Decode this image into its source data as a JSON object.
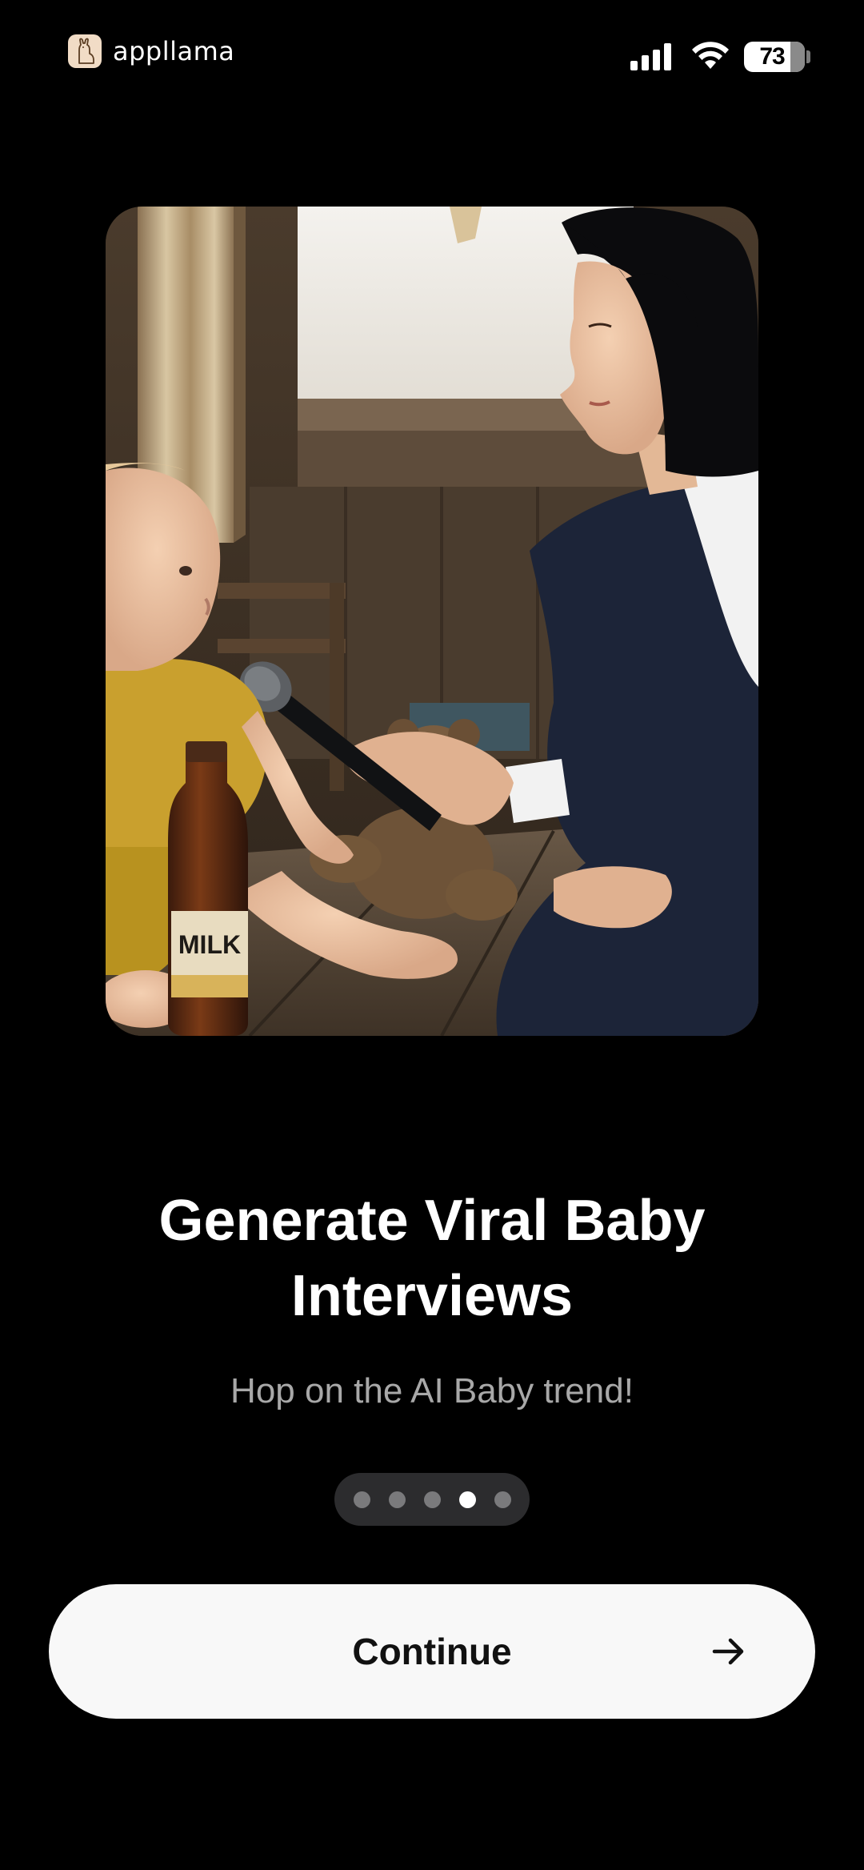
{
  "status_bar": {
    "brand_name": "appllama",
    "brand_icon": "llama-icon",
    "battery_level": "73",
    "signal_icon": "cellular-signal-icon",
    "wifi_icon": "wifi-icon"
  },
  "hero": {
    "bottle_label": "MILK"
  },
  "onboarding": {
    "title": "Generate Viral Baby Interviews",
    "subtitle": "Hop on the AI Baby trend!",
    "page_count": 5,
    "active_page": 4
  },
  "cta": {
    "label": "Continue",
    "arrow_icon": "arrow-right-icon"
  },
  "colors": {
    "background": "#000000",
    "button_bg": "#f8f8f8",
    "subtitle": "#a8a8a8",
    "dots_container": "#2c2c2e",
    "dot_inactive": "#7a7a7c",
    "dot_active": "#ffffff"
  }
}
